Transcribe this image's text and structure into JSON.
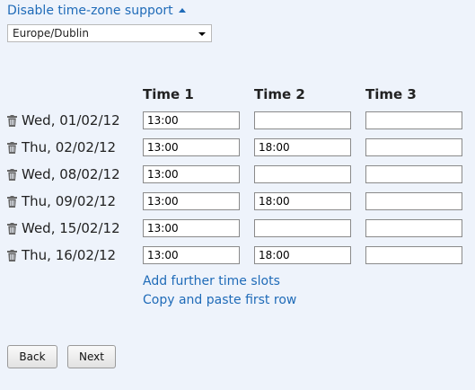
{
  "timezone": {
    "toggle_label": "Disable time-zone support",
    "selected": "Europe/Dublin"
  },
  "columns": [
    "Time 1",
    "Time 2",
    "Time 3"
  ],
  "rows": [
    {
      "date": "Wed, 01/02/12",
      "slots": [
        "13:00",
        "",
        ""
      ]
    },
    {
      "date": "Thu, 02/02/12",
      "slots": [
        "13:00",
        "18:00",
        ""
      ]
    },
    {
      "date": "Wed, 08/02/12",
      "slots": [
        "13:00",
        "",
        ""
      ]
    },
    {
      "date": "Thu, 09/02/12",
      "slots": [
        "13:00",
        "18:00",
        ""
      ]
    },
    {
      "date": "Wed, 15/02/12",
      "slots": [
        "13:00",
        "",
        ""
      ]
    },
    {
      "date": "Thu, 16/02/12",
      "slots": [
        "13:00",
        "18:00",
        ""
      ]
    }
  ],
  "links": {
    "add_slots": "Add further time slots",
    "copy_paste": "Copy and paste first row"
  },
  "buttons": {
    "back": "Back",
    "next": "Next"
  },
  "colors": {
    "background": "#eef3fb",
    "link": "#1f6bb8"
  },
  "icons": {
    "delete": "trash-icon",
    "collapse": "caret-up-icon",
    "dropdown": "chevron-down-icon"
  }
}
